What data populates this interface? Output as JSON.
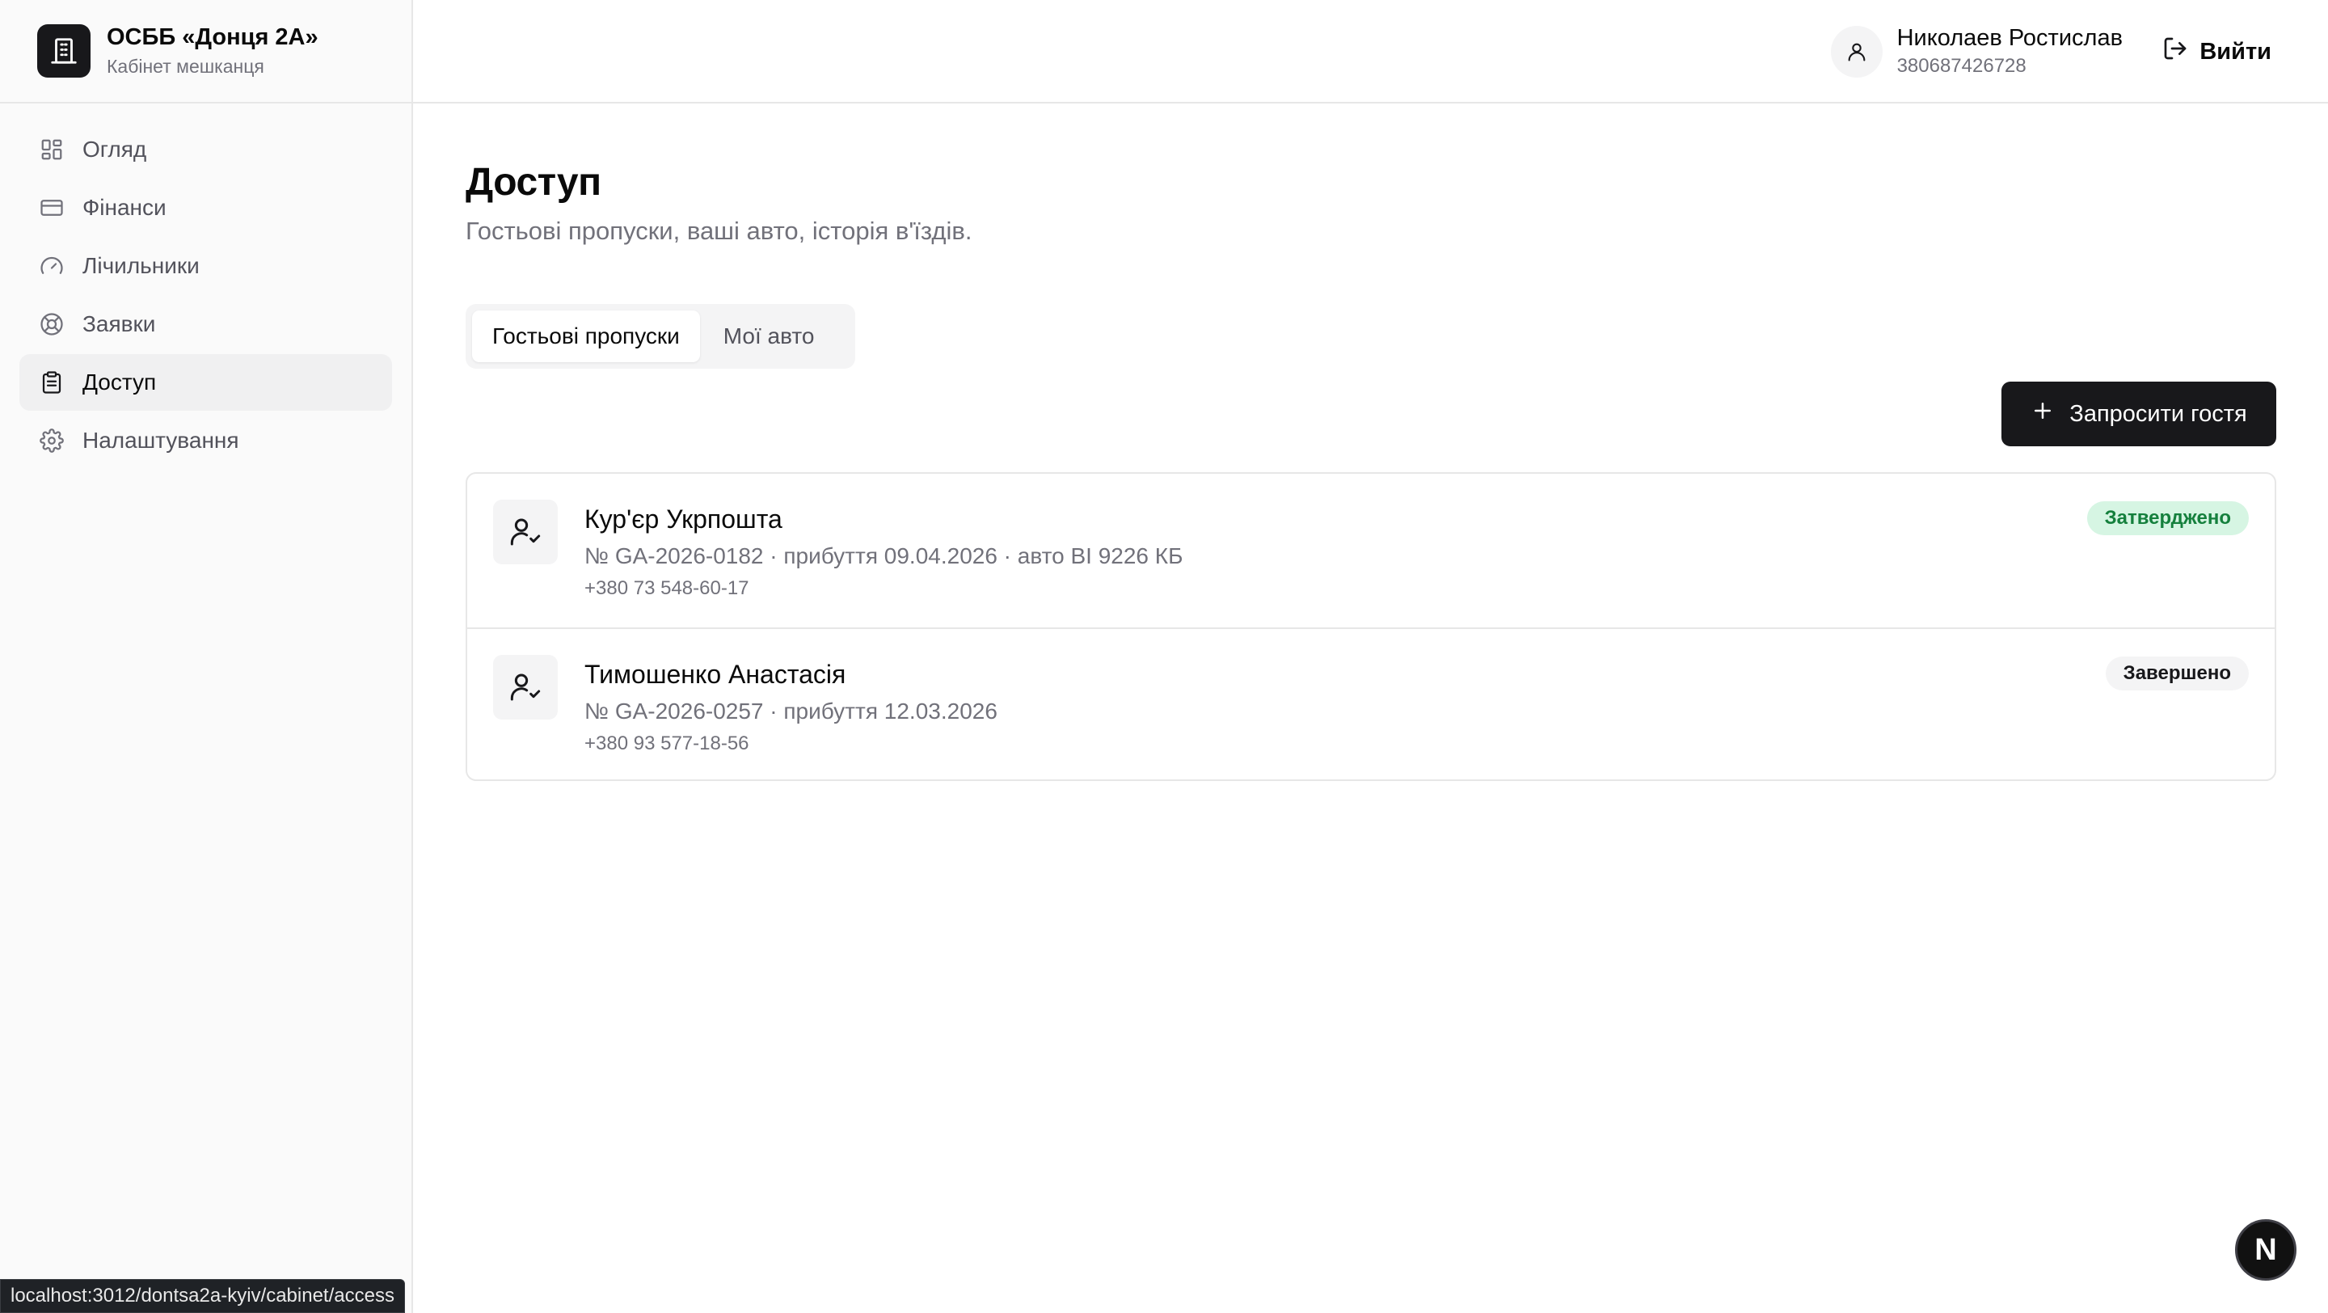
{
  "brand": {
    "title": "ОСББ «Донця 2А»",
    "subtitle": "Кабінет мешканця"
  },
  "sidebar": {
    "items": [
      {
        "label": "Огляд",
        "icon": "grid-icon"
      },
      {
        "label": "Фінанси",
        "icon": "credit-card-icon"
      },
      {
        "label": "Лічильники",
        "icon": "gauge-icon"
      },
      {
        "label": "Заявки",
        "icon": "lifebuoy-icon"
      },
      {
        "label": "Доступ",
        "icon": "clipboard-icon",
        "active": true
      },
      {
        "label": "Налаштування",
        "icon": "gear-icon"
      }
    ]
  },
  "header": {
    "user_name": "Николаев Ростислав",
    "user_phone": "380687426728",
    "logout_label": "Вийти"
  },
  "main": {
    "title": "Доступ",
    "subtitle": "Гостьові пропуски, ваші авто, історія в'їздів.",
    "tabs": [
      {
        "label": "Гостьові пропуски",
        "active": true
      },
      {
        "label": "Мої авто",
        "active": false
      }
    ],
    "invite_label": "Запросити гостя",
    "passes": [
      {
        "name": "Кур'єр Укрпошта",
        "meta": "№ GA-2026-0182 · прибуття 09.04.2026 · авто ВІ 9226 КБ",
        "phone": "+380 73 548-60-17",
        "status": "Затверджено"
      },
      {
        "name": "Тимошенко Анастасія",
        "meta": "№ GA-2026-0257 · прибуття 12.03.2026",
        "phone": "+380 93 577-18-56",
        "status": "Завершено"
      }
    ]
  },
  "statusbar": {
    "url": "localhost:3012/dontsa2a-kyiv/cabinet/access"
  },
  "fab": {
    "label": "N"
  },
  "colors": {
    "primary": "#18181b",
    "approved_bg": "#d6f5e3",
    "approved_text": "#15803d",
    "muted_text": "#71717a"
  }
}
